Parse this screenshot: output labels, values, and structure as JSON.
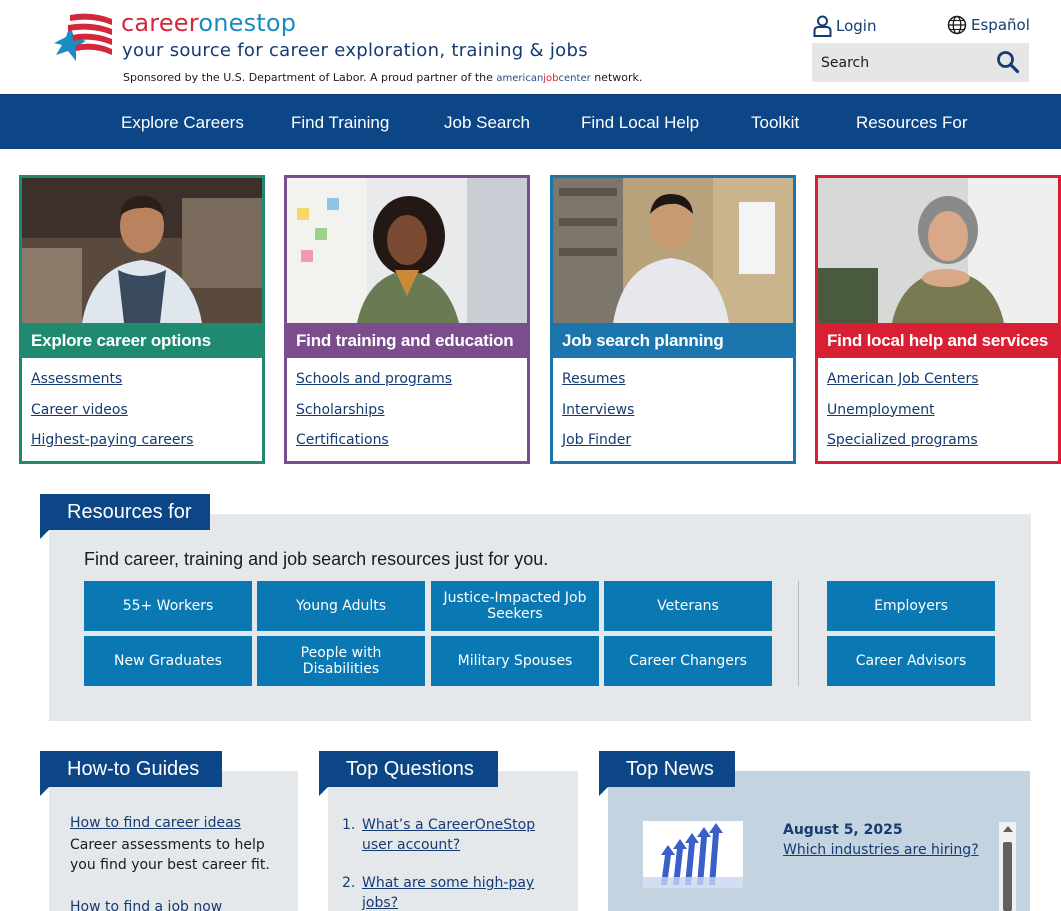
{
  "header": {
    "brand_part1": "career",
    "brand_part2": "onestop",
    "tagline": "your source for career exploration, training & jobs",
    "sponsor_text_before": "Sponsored by the U.S. Department of Labor. A proud partner of the ",
    "ajc_part1": "american",
    "ajc_part2": "job",
    "ajc_part3": "center",
    "sponsor_text_after": " network.",
    "login_label": "Login",
    "language_label": "Español",
    "search_placeholder": "Search"
  },
  "nav": {
    "items": [
      "Explore Careers",
      "Find Training",
      "Job Search",
      "Find Local Help",
      "Toolkit",
      "Resources For"
    ]
  },
  "cards": [
    {
      "title": "Explore career options",
      "color": "#1f8a70",
      "links": [
        "Assessments",
        "Career videos",
        "Highest-paying careers"
      ]
    },
    {
      "title": "Find training and education",
      "color": "#7b4d8c",
      "links": [
        "Schools and programs",
        "Scholarships",
        "Certifications"
      ]
    },
    {
      "title": "Job search planning",
      "color": "#1a76ad",
      "links": [
        "Resumes",
        "Interviews",
        "Job Finder"
      ]
    },
    {
      "title": "Find local help and services",
      "color": "#d91f34",
      "links": [
        "American Job Centers",
        "Unemployment",
        "Specialized programs"
      ]
    }
  ],
  "resources": {
    "heading": "Resources for",
    "intro": "Find career, training and job search resources just for you.",
    "buttons": [
      "55+ Workers",
      "Young Adults",
      "Justice-Impacted Job Seekers",
      "Veterans",
      "New Graduates",
      "People with Disabilities",
      "Military Spouses",
      "Career Changers"
    ],
    "side_buttons": [
      "Employers",
      "Career Advisors"
    ]
  },
  "guides": {
    "heading": "How-to Guides",
    "link1": "How to find career ideas",
    "text1": "Career assessments to help you find your best career fit.",
    "link2": "How to find a job now"
  },
  "questions": {
    "heading": "Top Questions",
    "items": [
      {
        "num": "1.",
        "text": "What’s a CareerOneStop user account?"
      },
      {
        "num": "2.",
        "text": "What are some high-pay jobs?"
      }
    ]
  },
  "news": {
    "heading": "Top News",
    "date": "August 5, 2025",
    "link": "Which industries are hiring?"
  }
}
